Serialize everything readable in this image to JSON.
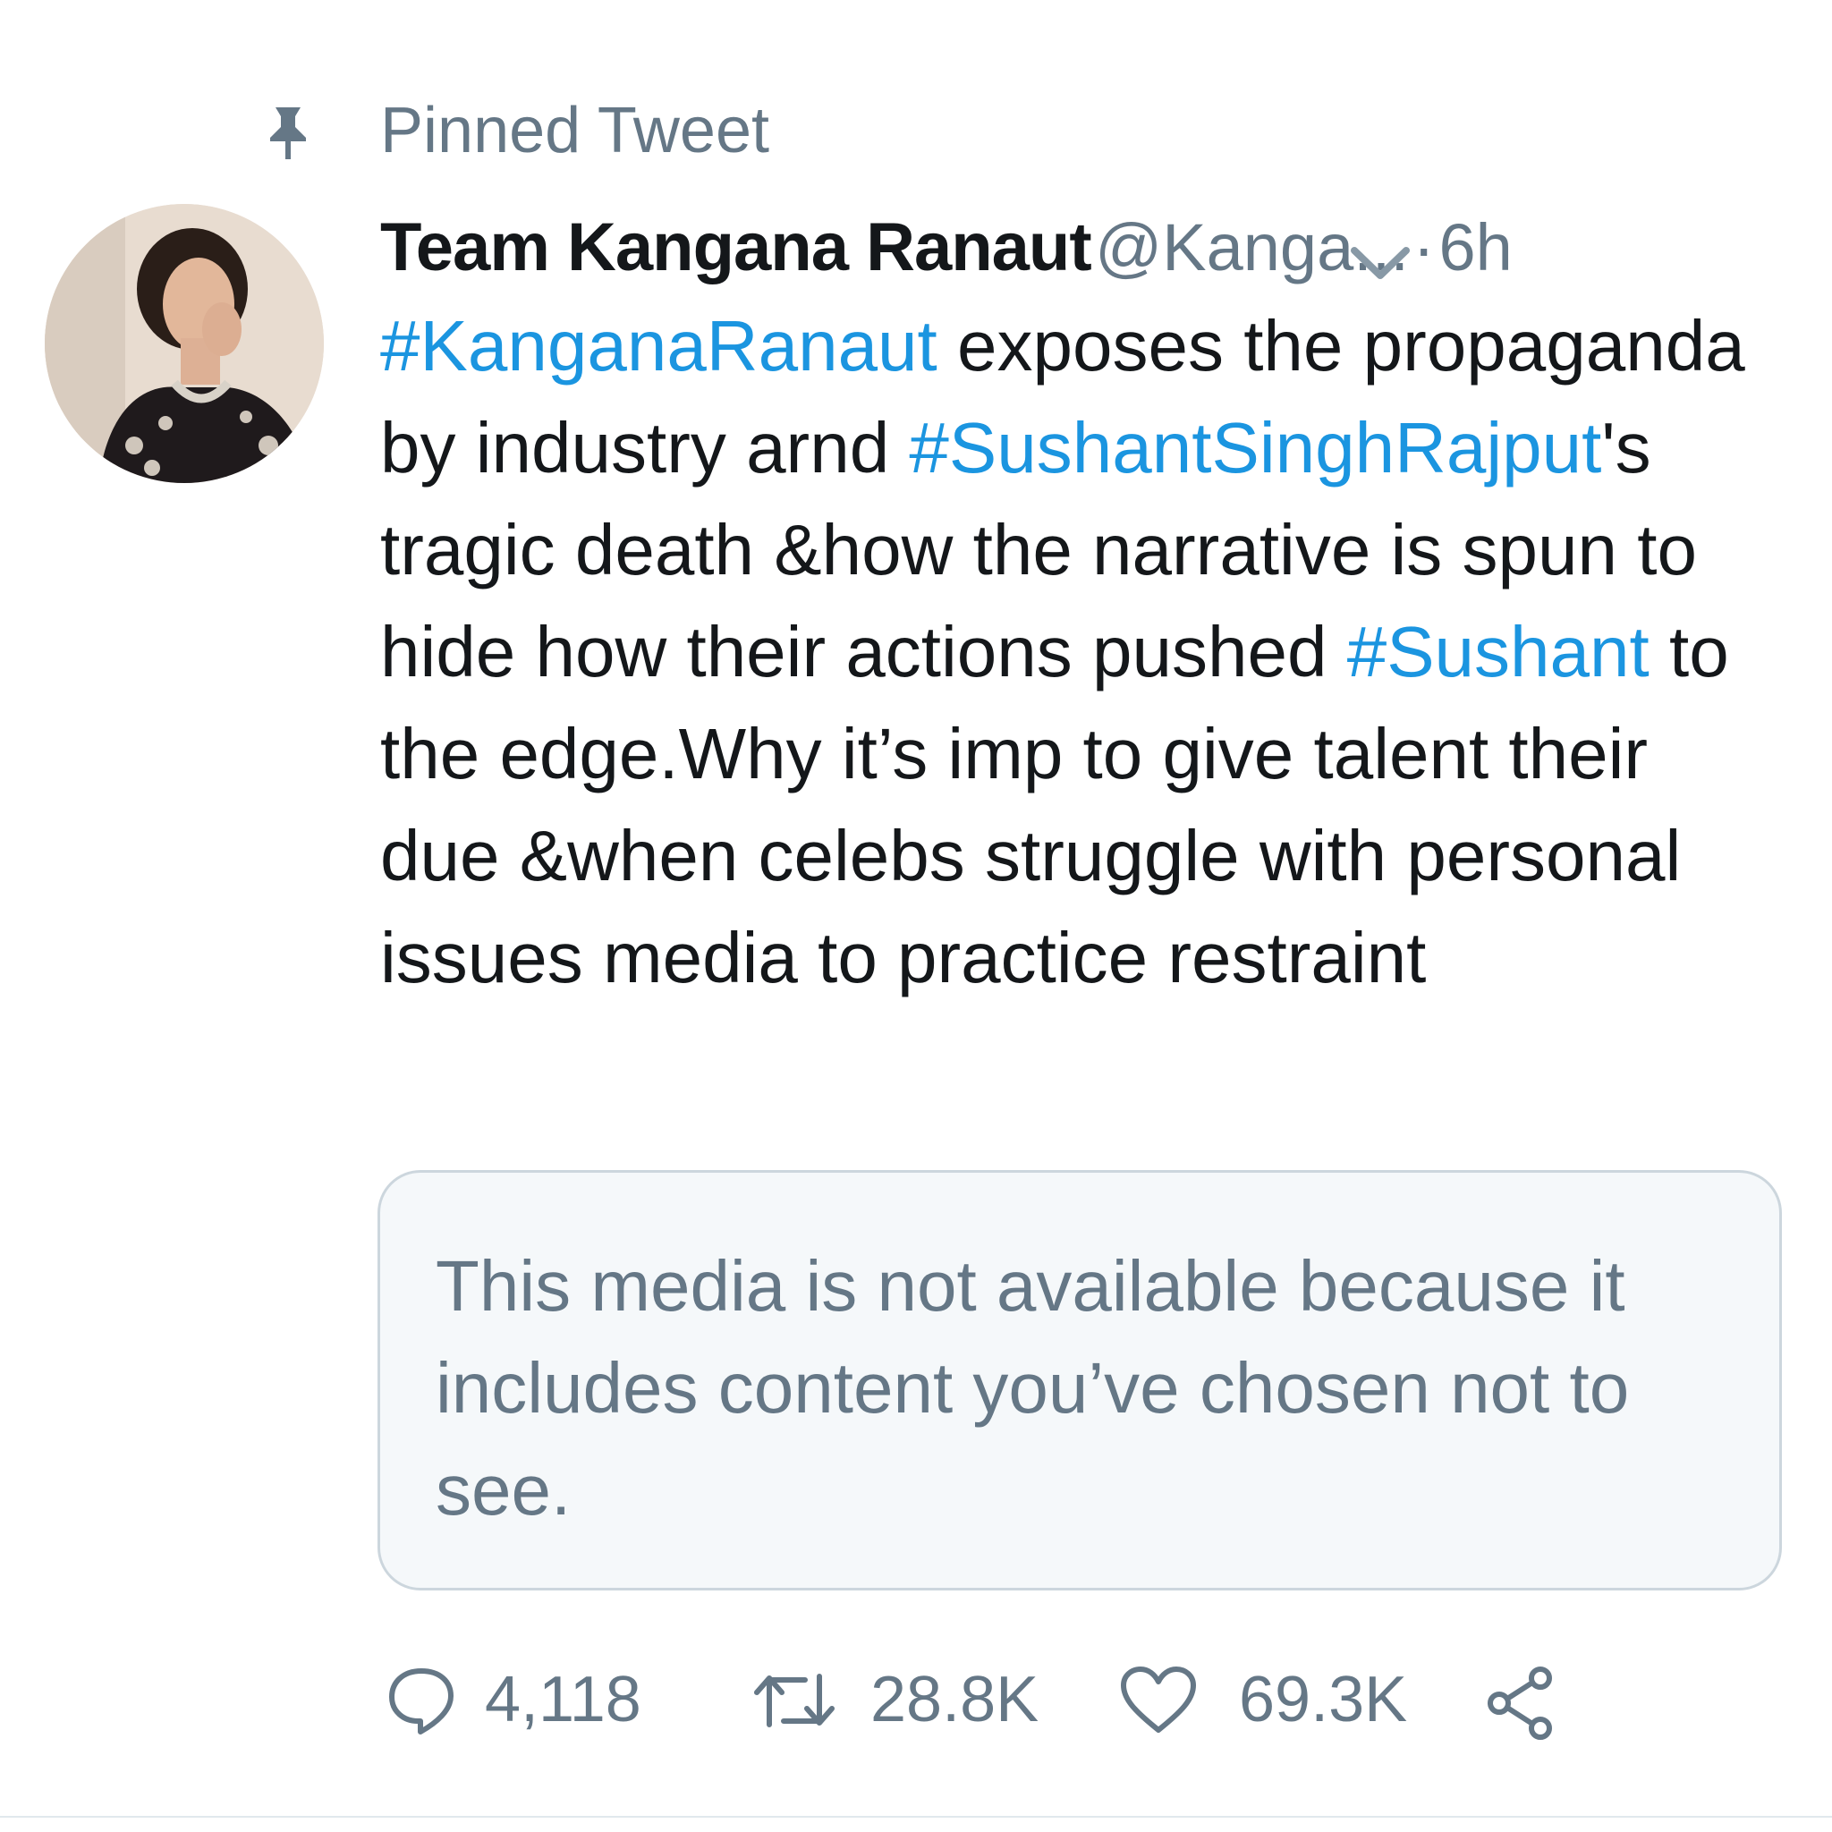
{
  "pinned": {
    "label": "Pinned Tweet",
    "icon": "pin-icon"
  },
  "tweet": {
    "author_name": "Team Kangana Ranaut",
    "handle": "@Kanga...",
    "separator": "·",
    "time": "6h",
    "menu_icon": "chevron-down-icon",
    "text": {
      "hashtag1": "#KanganaRanaut",
      "part1": " exposes the propaganda by industry arnd ",
      "hashtag2": "#SushantSinghRajput",
      "part2": "'s tragic death &how the narrative is spun to hide how their actions pushed ",
      "hashtag3": "#Sushant",
      "part3": " to the edge.Why it’s imp to give talent their due &when celebs struggle with personal issues media to practice restraint"
    },
    "media_notice": "This media is not available because it includes content you’ve chosen not to see.",
    "actions": {
      "reply_count": "4,118",
      "retweet_count": "28.8K",
      "like_count": "69.3K"
    }
  },
  "colors": {
    "text": "#14171a",
    "secondary": "#657786",
    "link": "#1b95e0",
    "card_bg": "#f5f8fa",
    "border": "#ccd6dd"
  }
}
